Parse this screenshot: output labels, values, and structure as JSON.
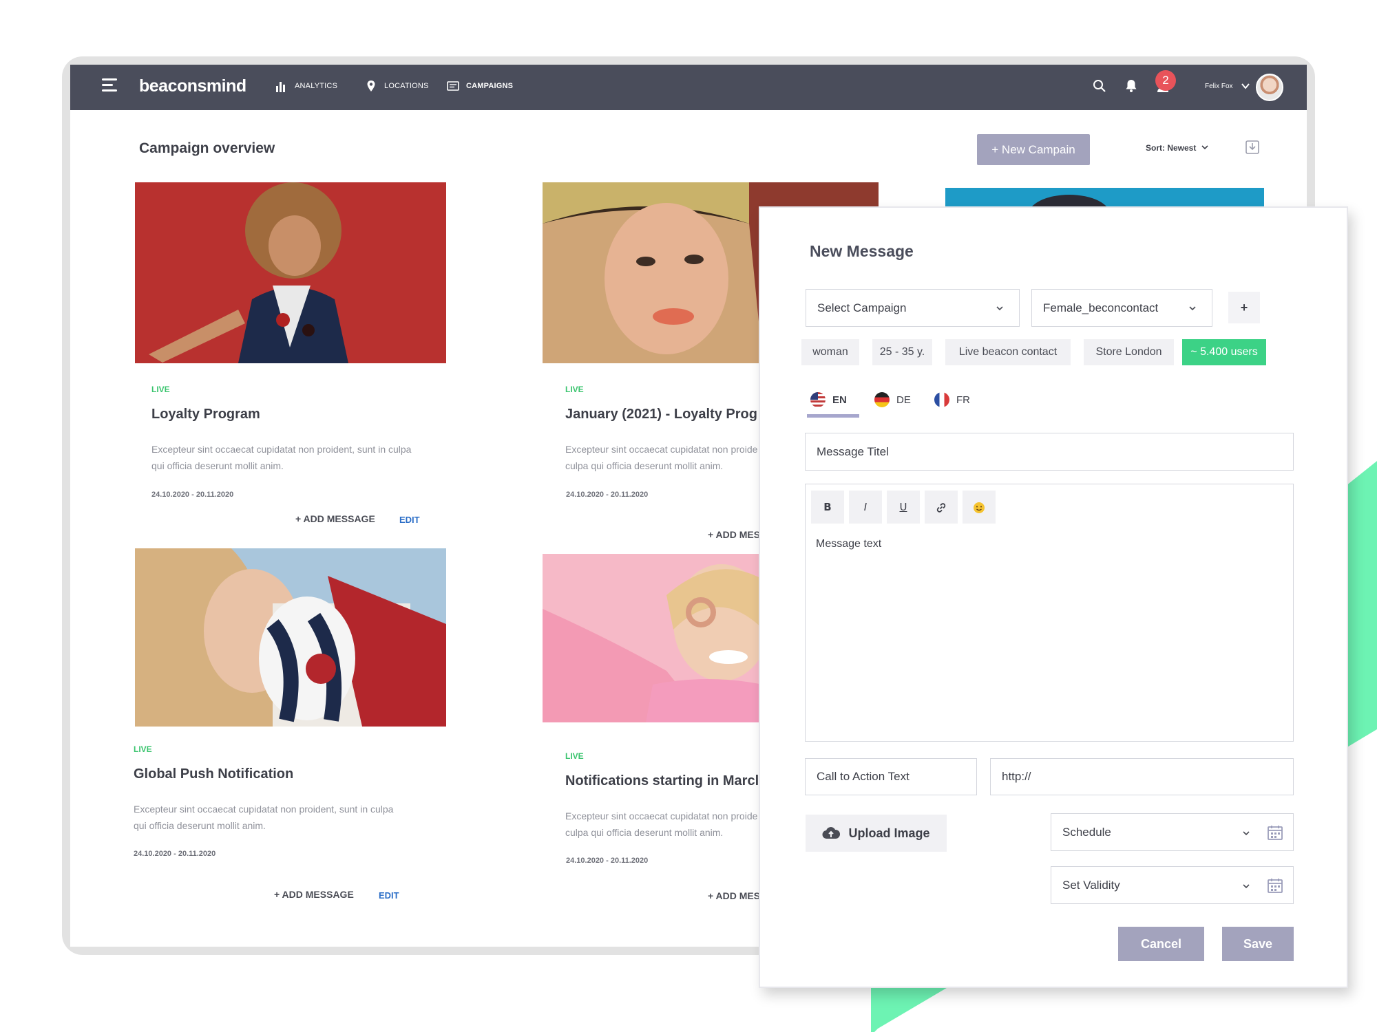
{
  "app": {
    "logo": "beaconsmind",
    "nav": [
      {
        "label": "ANALYTICS",
        "icon": "bar-chart-icon"
      },
      {
        "label": "LOCATIONS",
        "icon": "map-pin-icon"
      },
      {
        "label": "CAMPAIGNS",
        "icon": "message-list-icon",
        "active": true
      }
    ],
    "notification_count": "2",
    "user_name": "Felix Fox"
  },
  "overview": {
    "title": "Campaign overview",
    "new_campaign_label": "+ New Campain",
    "sort_label": "Sort: Newest"
  },
  "campaigns": [
    {
      "status": "LIVE",
      "title": "Loyalty Program",
      "description": "Excepteur sint occaecat cupidatat non proident, sunt in culpa qui officia deserunt mollit anim.",
      "dates": "24.10.2020 - 20.11.2020",
      "add_label": "+ ADD MESSAGE",
      "edit_label": "EDIT"
    },
    {
      "status": "LIVE",
      "title": "January (2021) - Loyalty Prog",
      "description": "Excepteur sint occaecat cupidatat non proide culpa qui officia deserunt mollit anim.",
      "dates": "24.10.2020 - 20.11.2020",
      "add_label": "+ ADD MES"
    },
    {
      "status": "LIVE",
      "title": "Global Push Notification",
      "description": "Excepteur sint occaecat cupidatat non proident, sunt in culpa qui officia deserunt mollit anim.",
      "dates": "24.10.2020 - 20.11.2020",
      "add_label": "+ ADD MESSAGE",
      "edit_label": "EDIT"
    },
    {
      "status": "LIVE",
      "title": "Notifications starting in Marcl",
      "description": "Excepteur sint occaecat cupidatat non proide culpa qui officia deserunt mollit anim.",
      "dates": "24.10.2020 - 20.11.2020",
      "add_label": "+ ADD MES"
    }
  ],
  "modal": {
    "title": "New Message",
    "campaign_select": "Select Campaign",
    "audience_select": "Female_beconcontact",
    "add_button": "+",
    "tags": [
      "woman",
      "25 - 35 y.",
      "Live beacon contact",
      "Store London",
      "~ 5.400 users"
    ],
    "languages": [
      {
        "code": "EN",
        "active": true
      },
      {
        "code": "DE"
      },
      {
        "code": "FR"
      }
    ],
    "message_title_placeholder": "Message Titel",
    "format_buttons": [
      "B",
      "I",
      "U"
    ],
    "message_text_placeholder": "Message text",
    "cta_placeholder": "Call to Action Text",
    "url_placeholder": "http://",
    "upload_label": "Upload Image",
    "schedule_label": "Schedule",
    "validity_label": "Set Validity",
    "cancel_label": "Cancel",
    "save_label": "Save"
  },
  "colors": {
    "topbar": "#4a4d5b",
    "accent_button": "#a3a3bd",
    "live_green": "#3ac46e",
    "users_tag": "#3cd286",
    "edit_link": "#2b6ec7"
  }
}
